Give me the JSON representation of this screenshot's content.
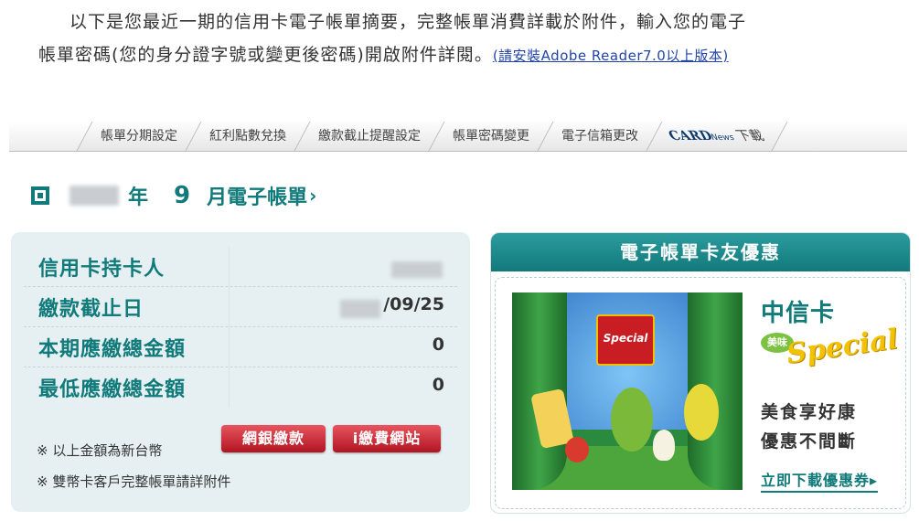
{
  "intro": {
    "line1": "以下是您最近一期的信用卡電子帳單摘要，完整帳單消費詳載於附件，輸入您的電子",
    "line2": "帳單密碼(您的身分證字號或變更後密碼)開啟附件詳閱。",
    "link": "(請安裝Adobe Reader7.0以上版本)"
  },
  "tabs": {
    "items": [
      {
        "label": "帳單分期設定"
      },
      {
        "label": "紅利點數兌換"
      },
      {
        "label": "繳款截止提醒設定"
      },
      {
        "label": "帳單密碼變更"
      },
      {
        "label": "電子信箱更改"
      }
    ],
    "last": {
      "brand": "CARD",
      "sub": "News",
      "label": "下載"
    }
  },
  "statement": {
    "year_suffix": "年",
    "month": "9",
    "title": "月電子帳單",
    "arrow": "›"
  },
  "summary": {
    "rows": [
      {
        "label": "信用卡持卡人",
        "value": ""
      },
      {
        "label": "繳款截止日",
        "value": "/09/25"
      },
      {
        "label": "本期應繳總金額",
        "value": "0"
      },
      {
        "label": "最低應繳總金額",
        "value": "0"
      }
    ],
    "note1": "※ 以上金額為新台幣",
    "note2": "※ 雙幣卡客戶完整帳單請詳附件",
    "btn_netbank": "網銀繳款",
    "btn_ipay": "i繳費網站"
  },
  "promo": {
    "header": "電子帳單卡友優惠",
    "brand": "中信卡",
    "badge": "美味",
    "special": "Special",
    "box_text": "Special",
    "line1": "美食享好康",
    "line2": "優惠不間斷",
    "link": "立即下載優惠券",
    "link_arrow": "▸"
  },
  "colors": {
    "teal": "#117a7a",
    "red": "#c81d23",
    "panel": "#e6f0f3"
  }
}
